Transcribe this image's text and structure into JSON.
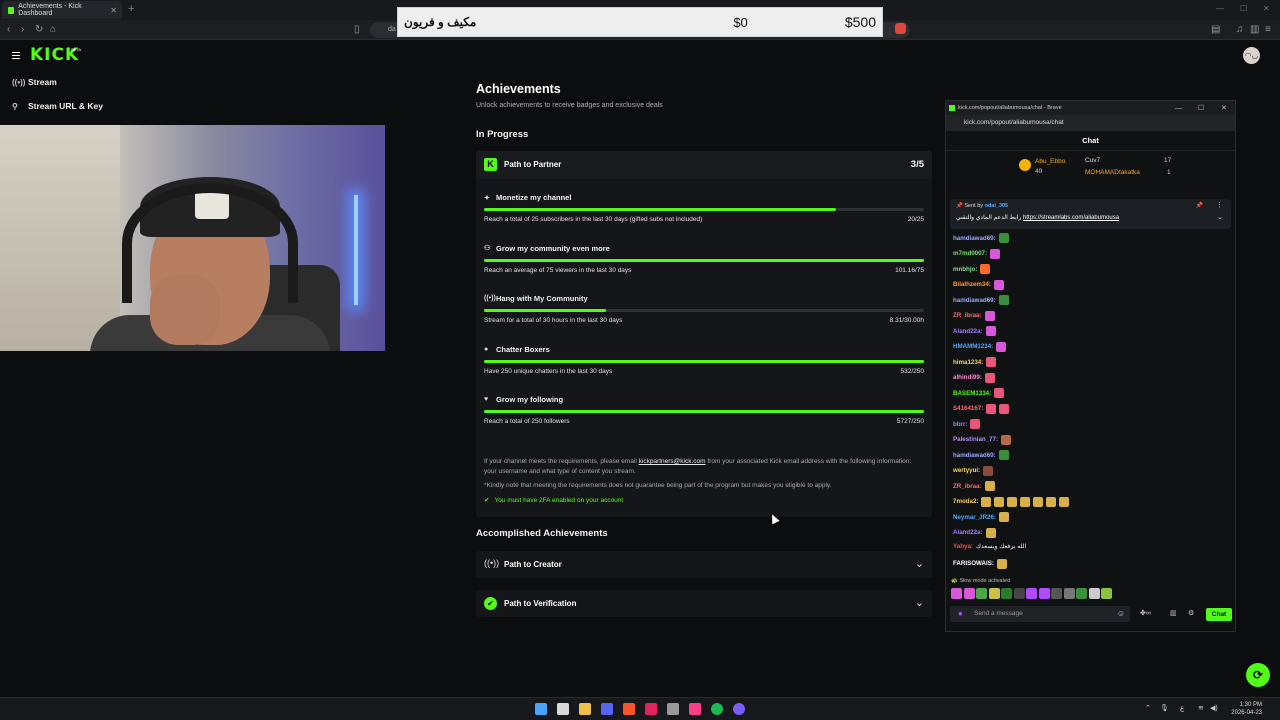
{
  "browser": {
    "tab_title": "Achievements - Kick Dashboard",
    "url_prefix": "da"
  },
  "banner": {
    "arabic_text": "مكيف و فريون",
    "value_start": "$0",
    "value_end": "$500"
  },
  "sidebar": {
    "items": [
      {
        "icon": "stream-icon",
        "label": "Stream"
      },
      {
        "icon": "key-icon",
        "label": "Stream URL & Key"
      }
    ]
  },
  "page": {
    "title": "Achievements",
    "subtitle": "Unlock achievements to receive badges and exclusive deals",
    "in_progress_heading": "In Progress",
    "accomplished_heading": "Accomplished Achievements"
  },
  "partner": {
    "title": "Path to Partner",
    "count": "3/5",
    "goals": [
      {
        "icon": "star-icon",
        "title": "Monetize my channel",
        "desc": "Reach a total of 25 subscribers in the last 30 days (gifted subs not included)",
        "value": "20/25",
        "progress": 0.8
      },
      {
        "icon": "community-icon",
        "title": "Grow my community even more",
        "desc": "Reach an average of 75 viewers in the last 30 days",
        "value": "101.16/75",
        "progress": 1.0
      },
      {
        "icon": "broadcast-icon",
        "title": "Hang with My Community",
        "desc": "Stream for a total of 30 hours in the last 30 days",
        "value": "8.31/30.00h",
        "progress": 0.277
      },
      {
        "icon": "chat-bubble-icon",
        "title": "Chatter Boxers",
        "desc": "Have 250 unique chatters in the last 30 days",
        "value": "532/250",
        "progress": 1.0
      },
      {
        "icon": "heart-icon",
        "title": "Grow my following",
        "desc": "Reach a total of 250 followers",
        "value": "5727/250",
        "progress": 1.0
      }
    ],
    "note_prefix": "If your channel meets the requirements, please email ",
    "note_email": "kickpartners@kick.com",
    "note_suffix": " from your associated Kick email address with the following information: your username and what type of content you stream.",
    "note_disclaimer": "*Kindly note that meeting the requirements does not guarantee being part of the program but makes you eligible to apply.",
    "twofa": "You must have 2FA enabled on your account"
  },
  "accomplished": [
    {
      "icon": "broadcast-icon",
      "title": "Path to Creator"
    },
    {
      "icon": "verified-icon",
      "title": "Path to Verification"
    }
  ],
  "chat": {
    "window_title": "kick.com/popout/aliabumousa/chat - Brave",
    "url": "kick.com/popout/aliabumousa/chat",
    "header": "Chat",
    "leaderboard": [
      {
        "name": "Abu_Ebbo",
        "value": "40",
        "color": "#f5b300"
      },
      {
        "name": "Cuv7",
        "value": "17",
        "color": "#e0e0e0"
      },
      {
        "name": "MOHAMADtakatka",
        "value": "1",
        "color": "#f5a623"
      }
    ],
    "pinned_by_label": "Sent by",
    "pinned_by_user": "odai_305",
    "pinned_text_ar": "رابط الدعم المادي والتقني",
    "pinned_link": "https://streamlabs.com/aliabumousa",
    "messages": [
      {
        "user": "hamdiawad69:",
        "color": "#9aa8ff",
        "emotes": [
          "#3a8f3a"
        ]
      },
      {
        "user": "m7md0007:",
        "color": "#79e26b",
        "emotes": [
          "#d957d9"
        ]
      },
      {
        "user": "mnbhjo:",
        "color": "#7fe08a",
        "emotes": [
          "#ff6a2a"
        ]
      },
      {
        "user": "Bilalhzem34:",
        "color": "#ff9a3c",
        "emotes": [
          "#d957d9"
        ]
      },
      {
        "user": "hamdiawad69:",
        "color": "#9aa8ff",
        "emotes": [
          "#3a8f3a"
        ]
      },
      {
        "user": "ZR_ibraa:",
        "color": "#ff6b6b",
        "emotes": [
          "#d957d9"
        ]
      },
      {
        "user": "Aland22a:",
        "color": "#a37bff",
        "emotes": [
          "#d957d9"
        ]
      },
      {
        "user": "HMAMM1234:",
        "color": "#53a9ff",
        "emotes": [
          "#d957d9"
        ]
      },
      {
        "user": "hima1234:",
        "color": "#ffd35a",
        "emotes": [
          "#e8577a"
        ]
      },
      {
        "user": "alhindi99:",
        "color": "#ff8ad8",
        "emotes": [
          "#e8577a"
        ]
      },
      {
        "user": "BASEM1334:",
        "color": "#53fc18",
        "emotes": [
          "#e8577a"
        ]
      },
      {
        "user": "S4164167:",
        "color": "#ff6b6b",
        "emotes": [
          "#e8577a",
          "#e8577a"
        ]
      },
      {
        "user": "bbrr:",
        "color": "#a37bff",
        "emotes": [
          "#e8577a"
        ]
      },
      {
        "user": "Palestinian_77:",
        "color": "#b88dff",
        "emotes": [
          "#b46a4a"
        ]
      },
      {
        "user": "hamdiawad69:",
        "color": "#9aa8ff",
        "emotes": [
          "#3a8f3a"
        ]
      },
      {
        "user": "wertyyui:",
        "color": "#ffd35a",
        "emotes": [
          "#8a4b3a"
        ]
      },
      {
        "user": "ZR_ibraa:",
        "color": "#ff6b6b",
        "emotes": [
          "#d8b04a"
        ]
      },
      {
        "user": "7moda2:",
        "color": "#ffd35a",
        "emotes": [
          "#d8b04a",
          "#d8b04a",
          "#d8b04a",
          "#d8b04a",
          "#d8b04a",
          "#d8b04a",
          "#d8b04a"
        ]
      },
      {
        "user": "Neymar_JR26:",
        "color": "#53a9ff",
        "emotes": [
          "#d8b04a"
        ]
      },
      {
        "user": "Aland22a:",
        "color": "#a37bff",
        "emotes": [
          "#d8b04a"
        ]
      },
      {
        "user": "Yahya:",
        "color": "#e05454",
        "text": "الله يرفعك ويسعدك",
        "emotes": []
      },
      {
        "user": "FARISOWAIS:",
        "color": "#ffffff",
        "emotes": [
          "#d8b04a"
        ]
      }
    ],
    "slow_mode": "Slow mode activated",
    "input_placeholder": "Send a message",
    "send_label": "Chat"
  },
  "taskbar": {
    "time": "1:30 PM",
    "date": "2026-04-23"
  },
  "colors": {
    "accent": "#53fc18",
    "background": "#0b0d0f",
    "card": "#141619"
  }
}
